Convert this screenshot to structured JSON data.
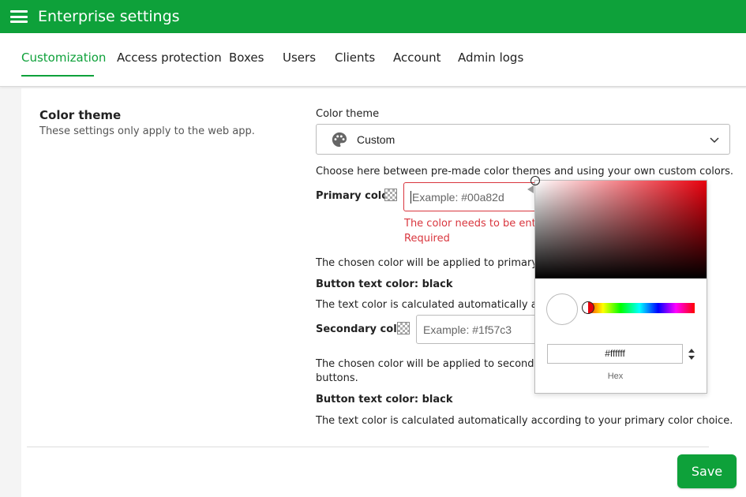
{
  "app": {
    "title": "Enterprise settings"
  },
  "colors": {
    "brand": "#0ea13a",
    "error": "#d9363e",
    "picker_hue": "#e8000d"
  },
  "tabs": [
    {
      "label": "Customization",
      "active": true
    },
    {
      "label": "Access protection"
    },
    {
      "label": "Boxes"
    },
    {
      "label": "Users"
    },
    {
      "label": "Clients"
    },
    {
      "label": "Account"
    },
    {
      "label": "Admin logs"
    }
  ],
  "section": {
    "title": "Color theme",
    "description": "These settings only apply to the web app."
  },
  "theme": {
    "label": "Color theme",
    "selected": "Custom",
    "help": "Choose here between pre-made color themes and using your own custom colors."
  },
  "primary": {
    "label": "Primary color",
    "placeholder": "Example: #00a82d",
    "error_format": "The color needs to be entere",
    "error_required": "Required",
    "applied_text": "The chosen color will be applied to primary butt",
    "button_text_label": "Button text color: black",
    "auto_text": "The text color is calculated automatically accord"
  },
  "secondary": {
    "label": "Secondary color",
    "placeholder": "Example: #1f57c3",
    "applied_line1": "The chosen color will be applied to secondary b",
    "applied_line2": "buttons.",
    "button_text_label": "Button text color: black",
    "auto_text": "The text color is calculated automatically according to your primary color choice."
  },
  "picker": {
    "hex_value": "#ffffff",
    "mode_label": "Hex"
  },
  "actions": {
    "save_label": "Save"
  }
}
